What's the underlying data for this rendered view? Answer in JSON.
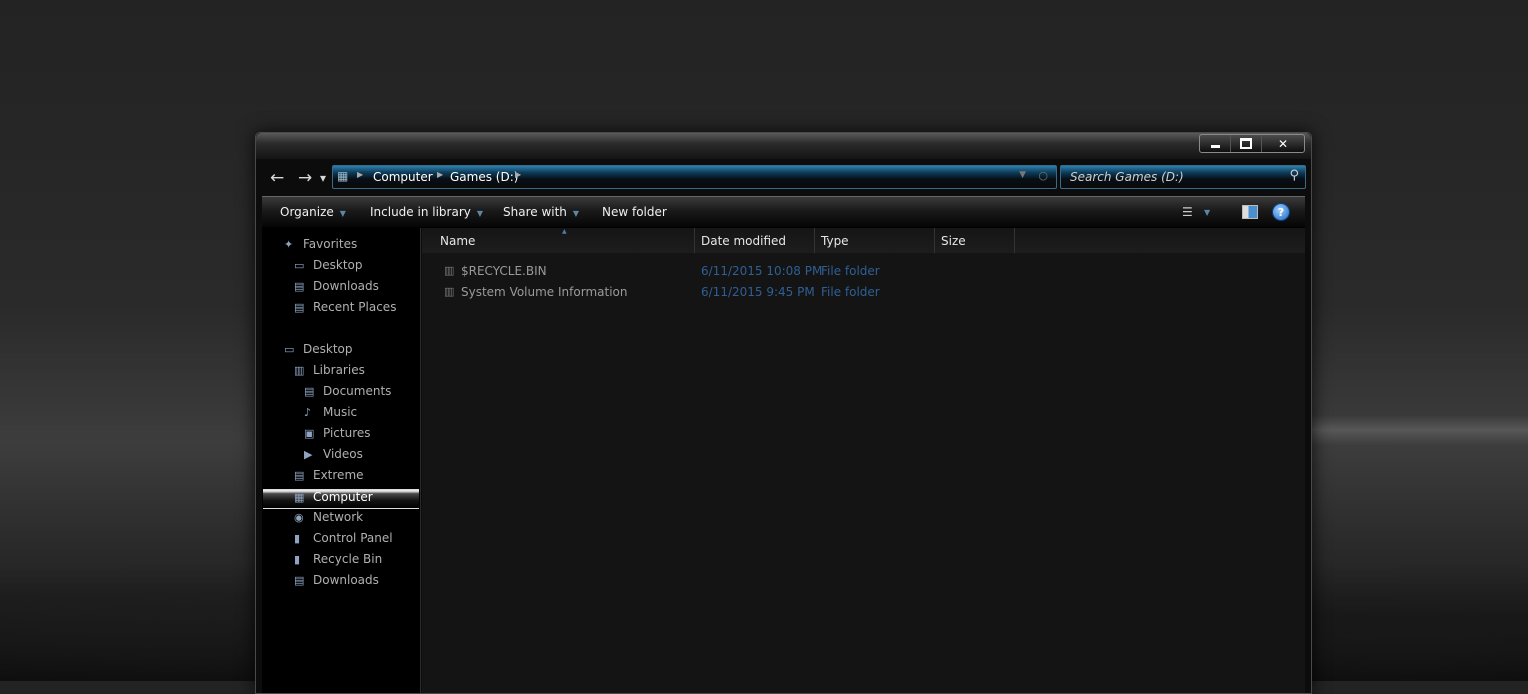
{
  "window": {
    "caption": {
      "minimize": "",
      "maximize": "",
      "close": "✕"
    }
  },
  "nav": {
    "back_glyph": "←",
    "forward_glyph": "→",
    "history_glyph": "▾",
    "breadcrumb": [
      "Computer",
      "Games (D:)"
    ],
    "search_placeholder": "Search Games (D:)"
  },
  "toolbar": {
    "organize": "Organize",
    "include_in_library": "Include in library",
    "share_with": "Share with",
    "new_folder": "New folder",
    "help_glyph": "?"
  },
  "navpane": {
    "favorites": {
      "label": "Favorites",
      "items": [
        "Desktop",
        "Downloads",
        "Recent Places"
      ]
    },
    "desktop": "Desktop",
    "libraries": {
      "label": "Libraries",
      "items": [
        "Documents",
        "Music",
        "Pictures",
        "Videos"
      ]
    },
    "others": [
      "Extreme",
      "Computer",
      "Network",
      "Control Panel",
      "Recycle Bin",
      "Downloads"
    ],
    "selected": "Computer"
  },
  "columns": {
    "name": "Name",
    "date_modified": "Date modified",
    "type": "Type",
    "size": "Size"
  },
  "files": [
    {
      "name": "$RECYCLE.BIN",
      "date": "6/11/2015 10:08 PM",
      "type": "File folder",
      "size": ""
    },
    {
      "name": "System Volume Information",
      "date": "6/11/2015 9:45 PM",
      "type": "File folder",
      "size": ""
    }
  ],
  "icons": {
    "folder": "folder-icon",
    "star": "favorites-star-icon",
    "computer": "computer-icon",
    "network": "network-icon",
    "search": "search-icon",
    "help": "help-icon"
  },
  "colors": {
    "accent": "#2d7fae",
    "meta_text": "#2f5f95",
    "selection": "#c8c8c8"
  }
}
